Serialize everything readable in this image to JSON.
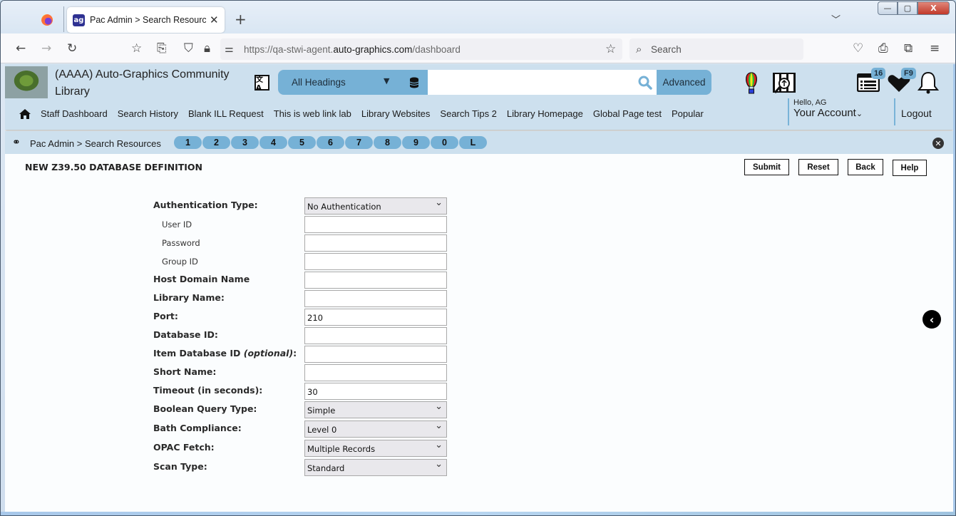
{
  "browser": {
    "tab_title": "Pac Admin > Search Resources",
    "tab_favicon": "ag-icon",
    "new_tab_label": "+",
    "url_prefix": "https://qa-stwi-agent.",
    "url_domain": "auto-graphics.com",
    "url_path": "/dashboard",
    "search_placeholder": "Search",
    "window_controls": {
      "minimize": "—",
      "maximize": "▢",
      "close": "X"
    }
  },
  "header": {
    "library_name_line1": "(AAAA) Auto-Graphics Community",
    "library_name_line2": "Library",
    "search_scope": "All Headings",
    "search_value": "",
    "advanced_label": "Advanced",
    "badges": {
      "list_count": "16",
      "favorites": "F9"
    },
    "menu": [
      "Staff Dashboard",
      "Search History",
      "Blank ILL Request",
      "This is web link lab",
      "Library Websites",
      "Search Tips 2",
      "Library Homepage",
      "Global Page test",
      "Popular"
    ],
    "account": {
      "greeting": "Hello, AG",
      "label": "Your Account"
    },
    "logout_label": "Logout"
  },
  "breadcrumb": {
    "text": "Pac Admin > Search Resources",
    "quick_tabs": [
      "1",
      "2",
      "3",
      "4",
      "5",
      "6",
      "7",
      "8",
      "9",
      "0",
      "L"
    ]
  },
  "page": {
    "title": "NEW Z39.50 DATABASE DEFINITION",
    "buttons": {
      "submit": "Submit",
      "reset": "Reset",
      "back": "Back",
      "help": "Help"
    }
  },
  "form": {
    "auth_type": {
      "label": "Authentication Type:",
      "value": "No Authentication"
    },
    "user_id": {
      "label": "User ID",
      "value": ""
    },
    "password": {
      "label": "Password",
      "value": ""
    },
    "group_id": {
      "label": "Group ID",
      "value": ""
    },
    "host_domain": {
      "label": "Host Domain Name",
      "value": ""
    },
    "library_name": {
      "label": "Library Name:",
      "value": ""
    },
    "port": {
      "label": "Port:",
      "value": "210"
    },
    "database_id": {
      "label": "Database ID:",
      "value": ""
    },
    "item_db_id": {
      "label": "Item Database ID ",
      "label_optional": "(optional)",
      "label_suffix": ":",
      "value": ""
    },
    "short_name": {
      "label": "Short Name:",
      "value": ""
    },
    "timeout": {
      "label": "Timeout (in seconds):",
      "value": "30"
    },
    "boolean_query": {
      "label": "Boolean Query Type:",
      "value": "Simple"
    },
    "bath_compliance": {
      "label": "Bath Compliance:",
      "value": "Level 0"
    },
    "opac_fetch": {
      "label": "OPAC Fetch:",
      "value": "Multiple Records"
    },
    "scan_type": {
      "label": "Scan Type:",
      "value": "Standard"
    }
  },
  "colors": {
    "header_bg": "#cde0ee",
    "accent": "#76b1d6",
    "page_bg": "#fbfdfe"
  }
}
